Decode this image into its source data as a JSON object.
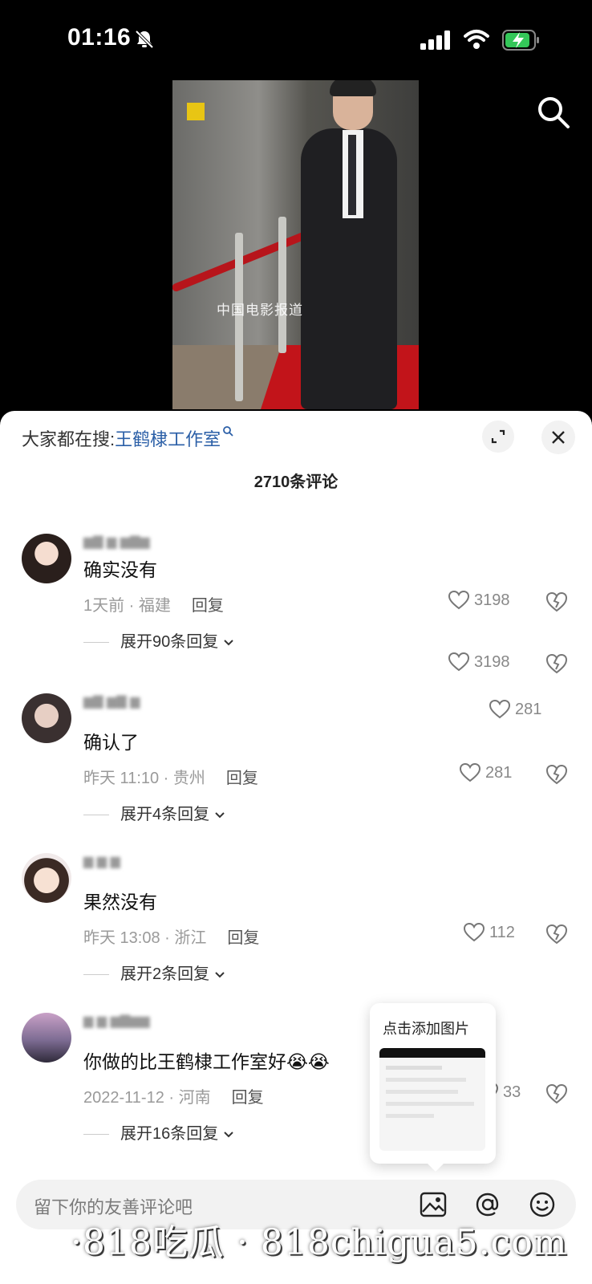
{
  "status_bar": {
    "time": "01:16"
  },
  "video": {
    "watermark": "中国电影报道"
  },
  "sheet": {
    "search_prefix": "大家都在搜:",
    "search_keyword": "王鹤棣工作室",
    "comment_count": "2710条评论"
  },
  "comments": [
    {
      "text": "确实没有",
      "time": "1天前",
      "location": "福建",
      "reply": "回复",
      "likes": "3198",
      "expand": "展开90条回复",
      "extra_likes": "3198"
    },
    {
      "text": "确认了",
      "time": "昨天 11:10",
      "location": "贵州",
      "reply": "回复",
      "likes": "281",
      "expand": "展开4条回复",
      "float_likes": "281"
    },
    {
      "text": "果然没有",
      "time": "昨天 13:08",
      "location": "浙江",
      "reply": "回复",
      "likes": "112",
      "expand": "展开2条回复"
    },
    {
      "text": "你做的比王鹤棣工作室好😭😭",
      "time": "2022-11-12",
      "location": "河南",
      "reply": "回复",
      "likes": "33",
      "expand": "展开16条回复"
    }
  ],
  "tooltip": {
    "title": "点击添加图片"
  },
  "input": {
    "placeholder": "留下你的友善评论吧"
  },
  "watermark": "·818吃瓜 · 818chigua5.com",
  "colors": {
    "link": "#2b5fa7",
    "battery": "#34c759"
  }
}
